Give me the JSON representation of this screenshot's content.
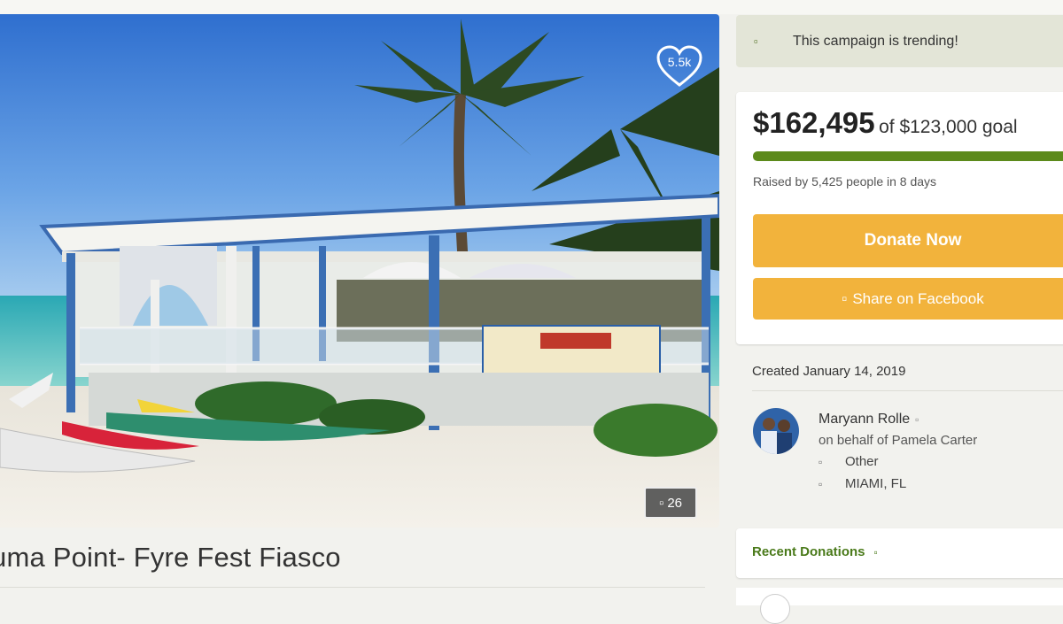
{
  "hero": {
    "likes": "5.5k",
    "photo_count": "26",
    "photo_icon": "camera-icon",
    "heart_icon": "heart-icon"
  },
  "campaign": {
    "title": "uma Point- Fyre Fest Fiasco"
  },
  "trending": {
    "icon": "trending-icon",
    "text": "This campaign is trending!"
  },
  "goal": {
    "raised": "$162,495",
    "goal_text": "of $123,000 goal",
    "progress_fraction": 1.0,
    "raised_by": "Raised by 5,425 people in 8 days",
    "donate_label": "Donate Now",
    "share_icon": "facebook-icon",
    "share_label": "Share on Facebook",
    "accent_color": "#f2b33c",
    "progress_color": "#5c8a1b"
  },
  "details": {
    "created": "Created January 14, 2019",
    "organizer": "Maryann Rolle",
    "on_behalf": "on behalf of Pamela Carter",
    "category": "Other",
    "location": "MIAMI, FL",
    "category_icon": "tag-icon",
    "location_icon": "map-pin-icon"
  },
  "recent": {
    "title": "Recent Donations",
    "icon": "info-icon"
  }
}
